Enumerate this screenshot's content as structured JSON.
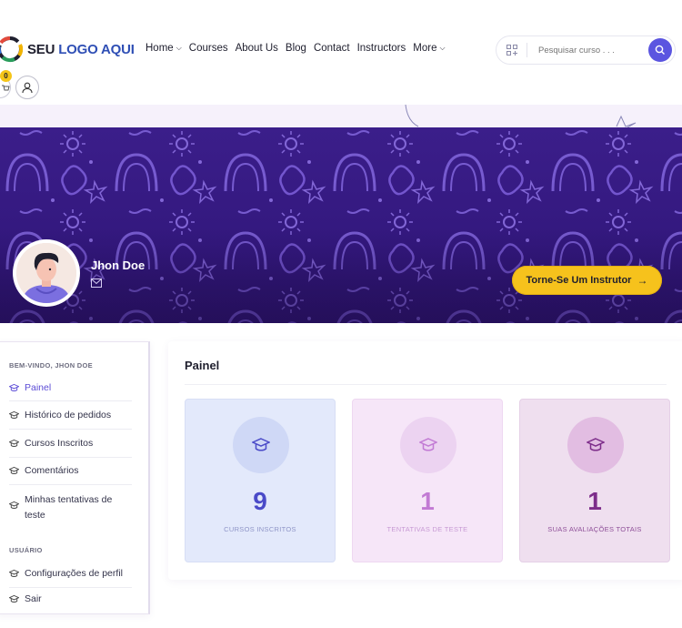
{
  "logo": {
    "word1": "SEU",
    "word2": "LOGO AQUI"
  },
  "nav": [
    {
      "label": "Home",
      "has_dropdown": true
    },
    {
      "label": "Courses",
      "has_dropdown": false
    },
    {
      "label": "About Us",
      "has_dropdown": false
    },
    {
      "label": "Blog",
      "has_dropdown": false
    },
    {
      "label": "Contact",
      "has_dropdown": false
    },
    {
      "label": "Instructors",
      "has_dropdown": false
    },
    {
      "label": "More",
      "has_dropdown": true
    }
  ],
  "search": {
    "placeholder": "Pesquisar curso . . ."
  },
  "cart": {
    "count": "0"
  },
  "profile": {
    "name": "Jhon Doe"
  },
  "cta": {
    "label": "Torne-Se Um Instrutor"
  },
  "sidebar": {
    "welcome": "BEM-VINDO, JHON DOE",
    "items": [
      {
        "label": "Painel",
        "active": true
      },
      {
        "label": "Histórico de pedidos",
        "active": false
      },
      {
        "label": "Cursos Inscritos",
        "active": false
      },
      {
        "label": "Comentários",
        "active": false
      },
      {
        "label": "Minhas tentativas de teste",
        "active": false
      }
    ],
    "user_section": "USUÁRIO",
    "user_items": [
      {
        "label": "Configurações de perfil"
      },
      {
        "label": "Sair"
      }
    ]
  },
  "main": {
    "title": "Painel",
    "cards": [
      {
        "value": "9",
        "label": "CURSOS INSCRITOS"
      },
      {
        "value": "1",
        "label": "TENTATIVAS DE TESTE"
      },
      {
        "value": "1",
        "label": "SUAS AVALIAÇÕES TOTAIS"
      }
    ]
  },
  "colors": {
    "accent": "#5b55e0",
    "cta": "#f6c21c",
    "banner": "#35197f"
  }
}
